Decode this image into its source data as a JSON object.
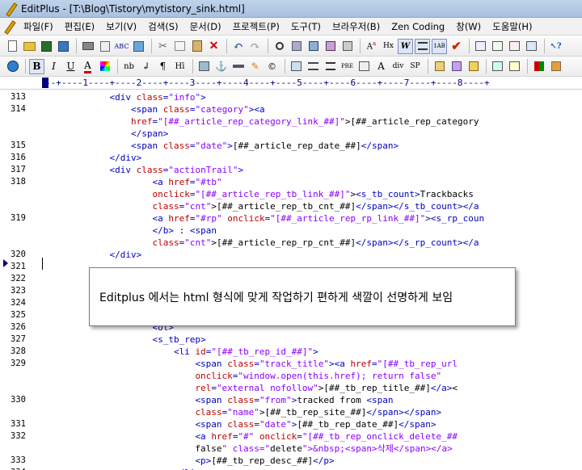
{
  "window": {
    "title": "EditPlus - [T:\\Blog\\Tistory\\mytistory_sink.html]"
  },
  "menu": [
    "파일(F)",
    "편집(E)",
    "보기(V)",
    "검색(S)",
    "문서(D)",
    "프로젝트(P)",
    "도구(T)",
    "브라우저(B)",
    "Zen Coding",
    "창(W)",
    "도움말(H)"
  ],
  "toolbar2": {
    "nb": "nb",
    "pre": "PRE",
    "div": "div",
    "sp": "SP"
  },
  "ruler": "--+----1----+----2----+----3----+----4----+----5----+----6----+----7----+----8----+",
  "callout": "Editplus 에서는 html 형식에 맞게 작업하기 편하게 색깔이 선명하게 보임",
  "lines": [
    {
      "n": "313",
      "code": "            <div class=\"info\">"
    },
    {
      "n": "314",
      "code": "                <span class=\"category\"><a"
    },
    {
      "n": "",
      "code": "                href=\"[##_article_rep_category_link_##]\">[##_article_rep_category"
    },
    {
      "n": "",
      "code": "                </span>"
    },
    {
      "n": "315",
      "code": "                <span class=\"date\">[##_article_rep_date_##]</span>"
    },
    {
      "n": "316",
      "code": "            </div>"
    },
    {
      "n": "317",
      "code": "            <div class=\"actionTrail\">"
    },
    {
      "n": "318",
      "code": "                    <a href=\"#tb\""
    },
    {
      "n": "",
      "code": "                    onclick=\"[##_article_rep_tb_link_##]\"><s_tb_count>Trackbacks"
    },
    {
      "n": "",
      "code": "                    class=\"cnt\">[##_article_rep_tb_cnt_##]</span></s_tb_count></a"
    },
    {
      "n": "319",
      "code": "                    <a href=\"#rp\" onclick=\"[##_article_rep_rp_link_##]\"><s_rp_coun"
    },
    {
      "n": "",
      "code": "                    </b> : <span"
    },
    {
      "n": "",
      "code": "                    class=\"cnt\">[##_article_rep_rp_cnt_##]</span></s_rp_count></a"
    },
    {
      "n": "320",
      "code": "            </div>"
    },
    {
      "n": "321",
      "code": ""
    },
    {
      "n": "322",
      "code": ""
    },
    {
      "n": "323",
      "code": ""
    },
    {
      "n": "324",
      "code": "                                                                ess_##]\"></sp"
    },
    {
      "n": "325",
      "code": ""
    },
    {
      "n": "326",
      "code": "                    <ol>"
    },
    {
      "n": "327",
      "code": "                    <s_tb_rep>"
    },
    {
      "n": "328",
      "code": "                        <li id=\"[##_tb_rep_id_##]\">"
    },
    {
      "n": "329",
      "code": "                            <span class=\"track_title\"><a href=\"[##_tb_rep_url"
    },
    {
      "n": "",
      "code": "                            onclick=\"window.open(this.href); return false\""
    },
    {
      "n": "",
      "code": "                            rel=\"external nofollow\">[##_tb_rep_title_##]</a><"
    },
    {
      "n": "330",
      "code": "                            <span class=\"from\">tracked from <span"
    },
    {
      "n": "",
      "code": "                            class=\"name\">[##_tb_rep_site_##]</span></span>"
    },
    {
      "n": "331",
      "code": "                            <span class=\"date\">[##_tb_rep_date_##]</span>"
    },
    {
      "n": "332",
      "code": "                            <a href=\"#\" onclick=\"[##_tb_rep_onclick_delete_##"
    },
    {
      "n": "",
      "code": "                            false\" class=\"delete\">&nbsp;<span>삭제</span></a>"
    },
    {
      "n": "333",
      "code": "                            <p>[##_tb_rep_desc_##]</p>"
    },
    {
      "n": "334",
      "code": "                        </li>"
    }
  ]
}
